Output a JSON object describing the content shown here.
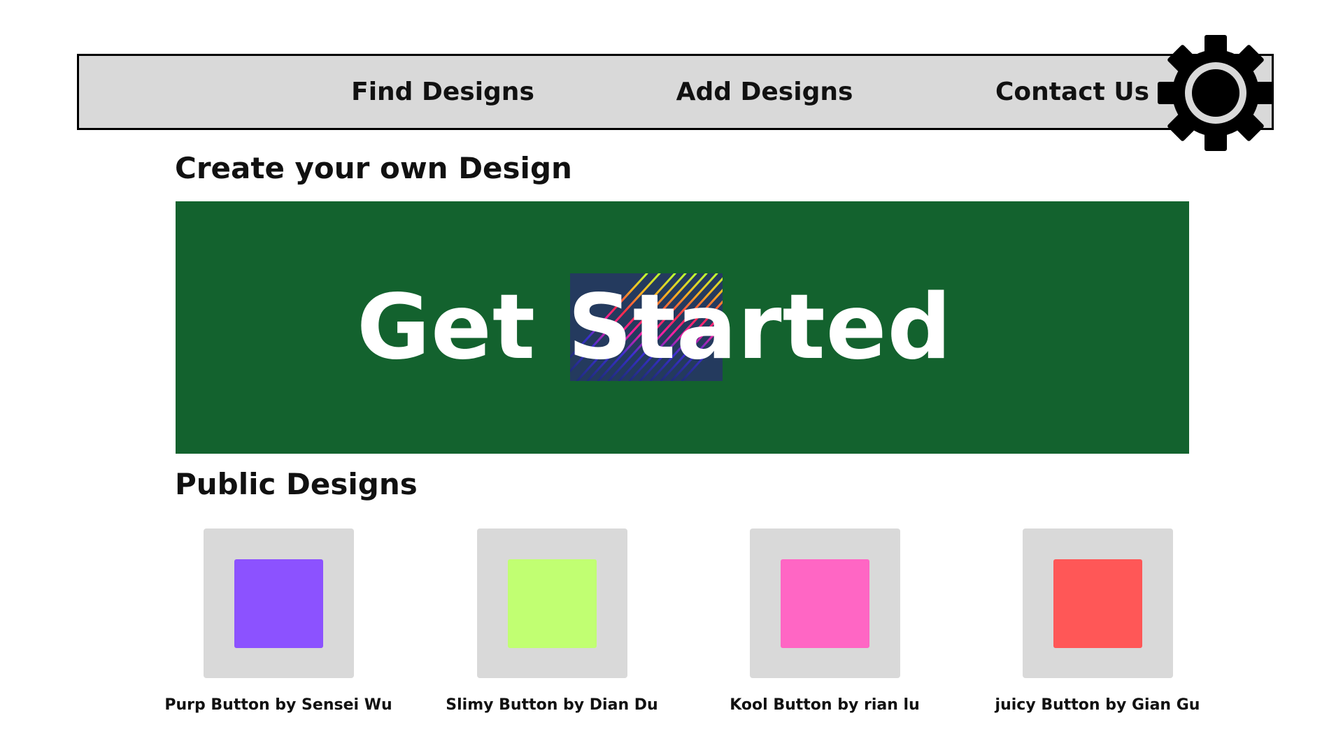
{
  "nav": {
    "items": [
      {
        "label": "Find Designs"
      },
      {
        "label": "Add Designs"
      },
      {
        "label": "Contact Us"
      }
    ],
    "settings_icon": "gear-icon"
  },
  "create_section": {
    "heading": "Create your own Design",
    "hero_label": "Get Started",
    "hero_bg_color": "#13622e"
  },
  "public_section": {
    "heading": "Public Designs",
    "designs": [
      {
        "caption": "Purp Button by Sensei Wu",
        "color": "#8c52ff"
      },
      {
        "caption": "Slimy Button by Dian Du",
        "color": "#c1ff72"
      },
      {
        "caption": "Kool Button by rian lu",
        "color": "#ff66c4"
      },
      {
        "caption": "juicy Button by Gian Gu",
        "color": "#ff5757"
      }
    ]
  }
}
